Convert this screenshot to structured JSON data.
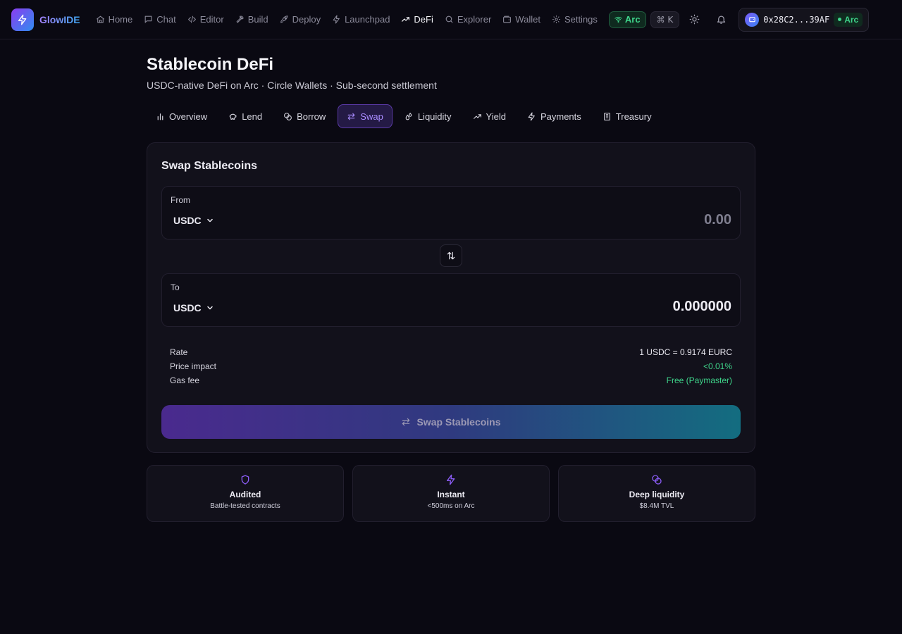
{
  "app": {
    "name": "GlowIDE"
  },
  "nav": [
    {
      "label": "Home",
      "icon": "home-icon"
    },
    {
      "label": "Chat",
      "icon": "chat-icon"
    },
    {
      "label": "Editor",
      "icon": "code-icon"
    },
    {
      "label": "Build",
      "icon": "hammer-icon"
    },
    {
      "label": "Deploy",
      "icon": "rocket-icon"
    },
    {
      "label": "Launchpad",
      "icon": "bolt-icon"
    },
    {
      "label": "DeFi",
      "icon": "trending-up-icon",
      "active": true
    },
    {
      "label": "Explorer",
      "icon": "search-icon"
    },
    {
      "label": "Wallet",
      "icon": "wallet-icon"
    },
    {
      "label": "Settings",
      "icon": "gear-icon"
    }
  ],
  "network_badge": "Arc",
  "shortcut": "⌘ K",
  "wallet": {
    "address": "0x28C2...39AF",
    "network": "Arc"
  },
  "page": {
    "title": "Stablecoin DeFi",
    "subtitle": "USDC-native DeFi on Arc · Circle Wallets · Sub-second settlement"
  },
  "tabs": [
    {
      "label": "Overview",
      "icon": "bar-chart-icon"
    },
    {
      "label": "Lend",
      "icon": "piggy-bank-icon"
    },
    {
      "label": "Borrow",
      "icon": "coins-icon"
    },
    {
      "label": "Swap",
      "icon": "swap-icon",
      "active": true
    },
    {
      "label": "Liquidity",
      "icon": "droplets-icon"
    },
    {
      "label": "Yield",
      "icon": "trending-up-icon"
    },
    {
      "label": "Payments",
      "icon": "bolt-icon"
    },
    {
      "label": "Treasury",
      "icon": "bank-icon"
    }
  ],
  "swap": {
    "title": "Swap Stablecoins",
    "from": {
      "label": "From",
      "token": "USDC",
      "placeholder": "0.00"
    },
    "to": {
      "label": "To",
      "token": "USDC",
      "amount": "0.000000"
    },
    "details": [
      {
        "label": "Rate",
        "value": "1 USDC = 0.9174 EURC",
        "accent": false
      },
      {
        "label": "Price impact",
        "value": "<0.01%",
        "accent": true
      },
      {
        "label": "Gas fee",
        "value": "Free (Paymaster)",
        "accent": true
      }
    ],
    "button": "Swap Stablecoins"
  },
  "features": [
    {
      "title": "Audited",
      "desc": "Battle-tested contracts",
      "icon": "shield-icon"
    },
    {
      "title": "Instant",
      "desc": "<500ms on Arc",
      "icon": "bolt-icon"
    },
    {
      "title": "Deep liquidity",
      "desc": "$8.4M TVL",
      "icon": "coins-icon"
    }
  ],
  "colors": {
    "accent_purple": "#8b5cf6",
    "accent_green": "#3fd58b",
    "background": "#0a0912",
    "card": "#12111b"
  }
}
